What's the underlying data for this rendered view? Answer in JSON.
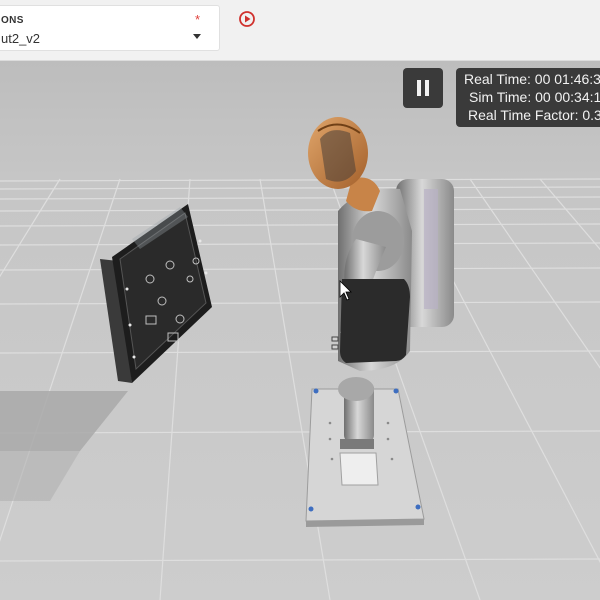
{
  "selector": {
    "label": "ONS",
    "value": "ut2_v2",
    "required_mark": "*"
  },
  "icons": {
    "play": "play-circle-icon",
    "dropdown": "chevron-down-icon",
    "pause": "pause-icon"
  },
  "stats": {
    "real_time": "Real Time: 00 01:46:3",
    "sim_time": "Sim Time: 00 00:34:1",
    "real_time_factor": "Real Time Factor: 0.3"
  },
  "colors": {
    "accent_red": "#d0312d",
    "overlay_bg": "#3a3a3a",
    "ground": "#c9c9c9"
  }
}
